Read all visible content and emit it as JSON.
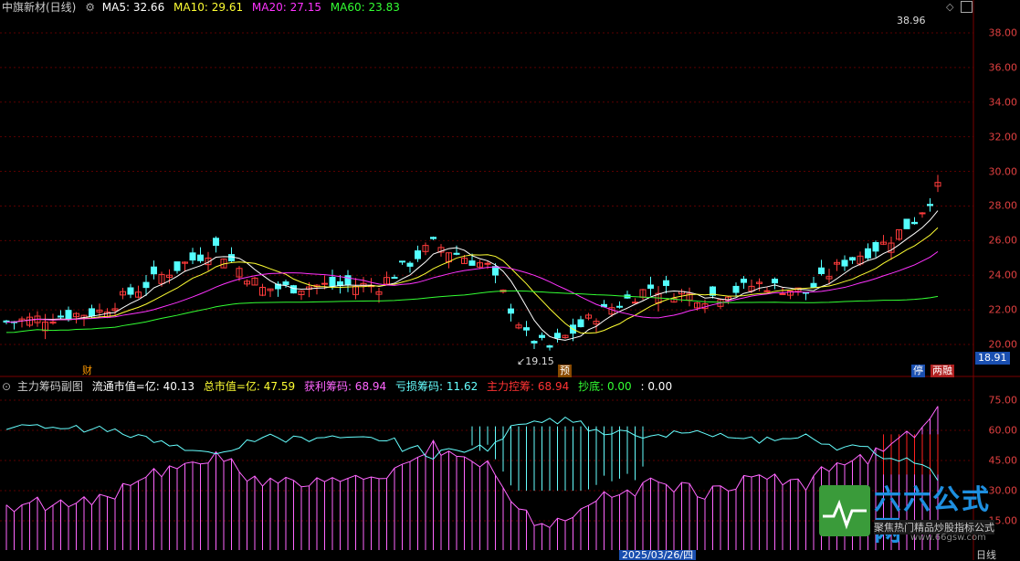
{
  "main_legend": {
    "stock": "中旗新材(日线)",
    "ma5_label": "MA5: 32.66",
    "ma10_label": "MA10: 29.61",
    "ma20_label": "MA20: 27.15",
    "ma60_label": "MA60: 23.83"
  },
  "price_axis": {
    "ticks": [
      "38.00",
      "36.00",
      "34.00",
      "32.00",
      "30.00",
      "28.00",
      "26.00",
      "24.00",
      "22.00",
      "20.00"
    ],
    "current_price": "18.91"
  },
  "annotations": {
    "high_label": "38.96",
    "low_label": "19.15",
    "marker_cai": "财",
    "marker_yu": "预",
    "marker_ting": "停",
    "marker_liangrong": "两融"
  },
  "sub_legend": {
    "title": "主力筹码副图",
    "float_cap": "流通市值=亿: 40.13",
    "total_cap": "总市值=亿: 47.59",
    "profit_chips": "获利筹码: 68.94",
    "loss_chips": "亏损筹码: 11.62",
    "main_control": "主力控筹: 68.94",
    "bottom": "抄底: 0.00",
    "extra": ": 0.00"
  },
  "sub_axis": {
    "ticks": [
      "75.00",
      "60.00",
      "45.00",
      "30.00",
      "15.00"
    ]
  },
  "bottom_bar": {
    "date_label": "2025/03/26/四",
    "period_label": "日线"
  },
  "watermark": {
    "text": "六六公式网",
    "url": "www.66gsw.com",
    "slogan": "聚焦热门精品炒股指标公式"
  },
  "colors": {
    "up": "#ff3b3b",
    "down": "#54ffff",
    "ma5": "#ffffff",
    "ma10": "#ffff33",
    "ma20": "#ff33ff",
    "ma60": "#33ff33",
    "grid": "#5a0000",
    "profit": "#ff66ff",
    "loss": "#66ffff"
  }
}
